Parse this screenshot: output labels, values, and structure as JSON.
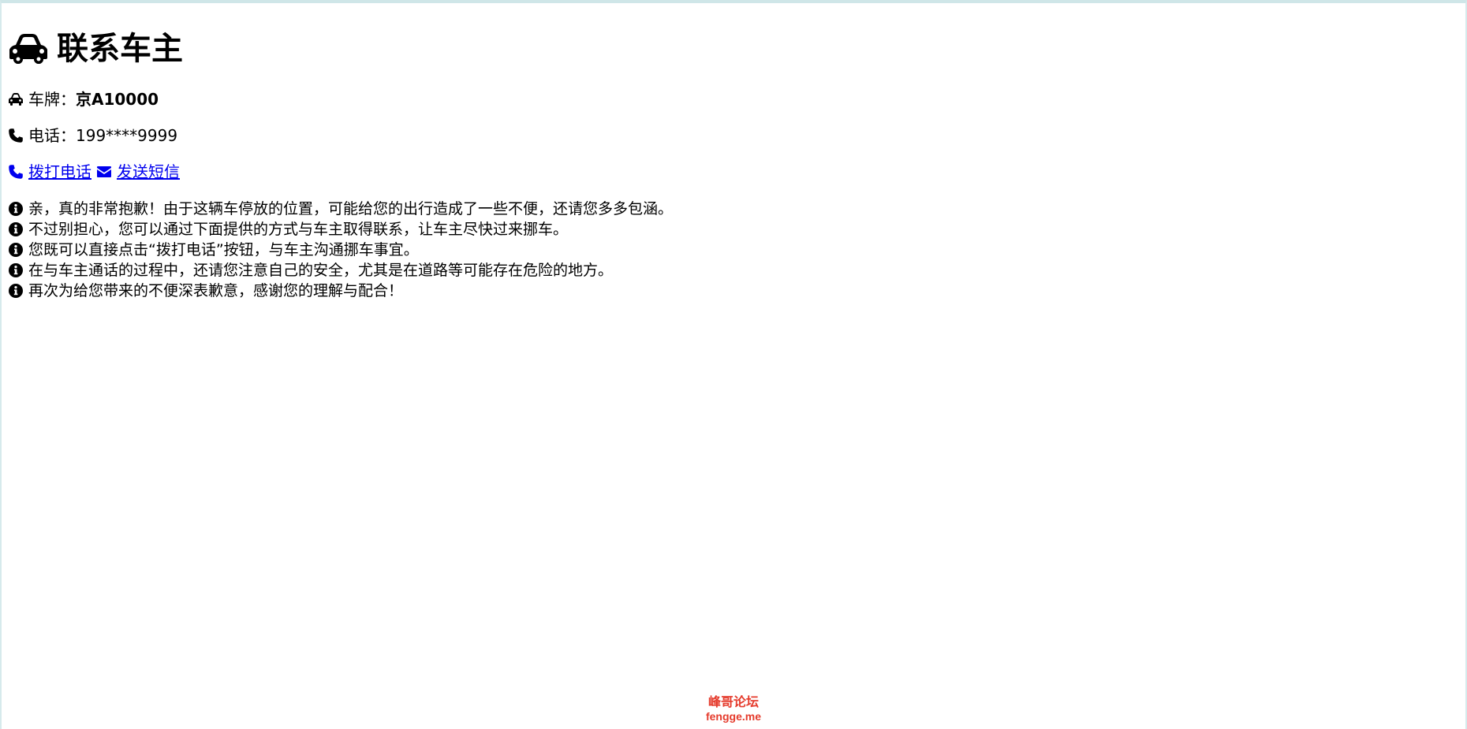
{
  "title": "联系车主",
  "plate": {
    "label": "车牌：",
    "value": "京A10000"
  },
  "phone": {
    "label": "电话：",
    "value": "199****9999"
  },
  "actions": {
    "call_label": "拨打电话",
    "sms_label": "发送短信"
  },
  "notes": [
    "亲，真的非常抱歉！由于这辆车停放的位置，可能给您的出行造成了一些不便，还请您多多包涵。",
    "不过别担心，您可以通过下面提供的方式与车主取得联系，让车主尽快过来挪车。",
    "您既可以直接点击“拨打电话”按钮，与车主沟通挪车事宜。",
    "在与车主通话的过程中，还请您注意自己的安全，尤其是在道路等可能存在危险的地方。",
    "再次为给您带来的不便深表歉意，感谢您的理解与配合！"
  ],
  "footer": {
    "brand_cn": "峰哥论坛",
    "brand_en": "fengge.me"
  },
  "icons": {
    "title": "car-icon",
    "plate": "car-icon",
    "phone": "phone-icon",
    "call": "phone-icon",
    "sms": "envelope-icon",
    "note": "info-circle-icon"
  },
  "colors": {
    "link": "#0000ee",
    "footer": "#e53b2c",
    "frame": "#cfe6e8"
  }
}
